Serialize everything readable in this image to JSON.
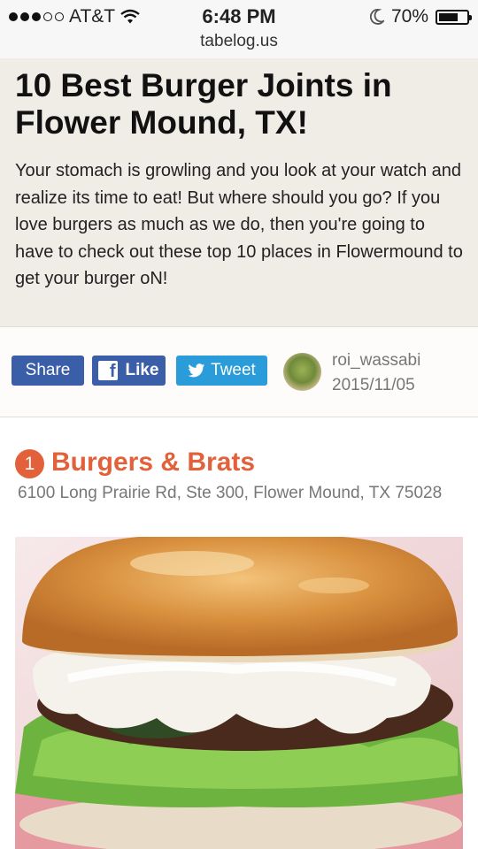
{
  "status_bar": {
    "carrier": "AT&T",
    "time": "6:48 PM",
    "battery": "70%",
    "battery_level": 0.7
  },
  "browser": {
    "url": "tabelog.us"
  },
  "article": {
    "title": "10 Best Burger Joints in Flower Mound, TX!",
    "intro": "Your stomach is growling and you look at your watch and realize its time to eat! But where should you go? If you love burgers as much as we do, then you're going to have to check out these top 10 places in Flowermound to get your burger oN!"
  },
  "social": {
    "share_label": "Share",
    "like_label": "Like",
    "tweet_label": "Tweet"
  },
  "author": {
    "name": "roi_wassabi",
    "date": "2015/11/05"
  },
  "restaurants": [
    {
      "rank": "1",
      "name": "Burgers & Brats",
      "address": "6100 Long Prairie Rd, Ste 300, Flower Mound, TX 75028"
    }
  ],
  "colors": {
    "accent": "#e2603a",
    "facebook": "#3b5ea8",
    "twitter": "#2a9cd9",
    "header_bg": "#f0ece6"
  }
}
